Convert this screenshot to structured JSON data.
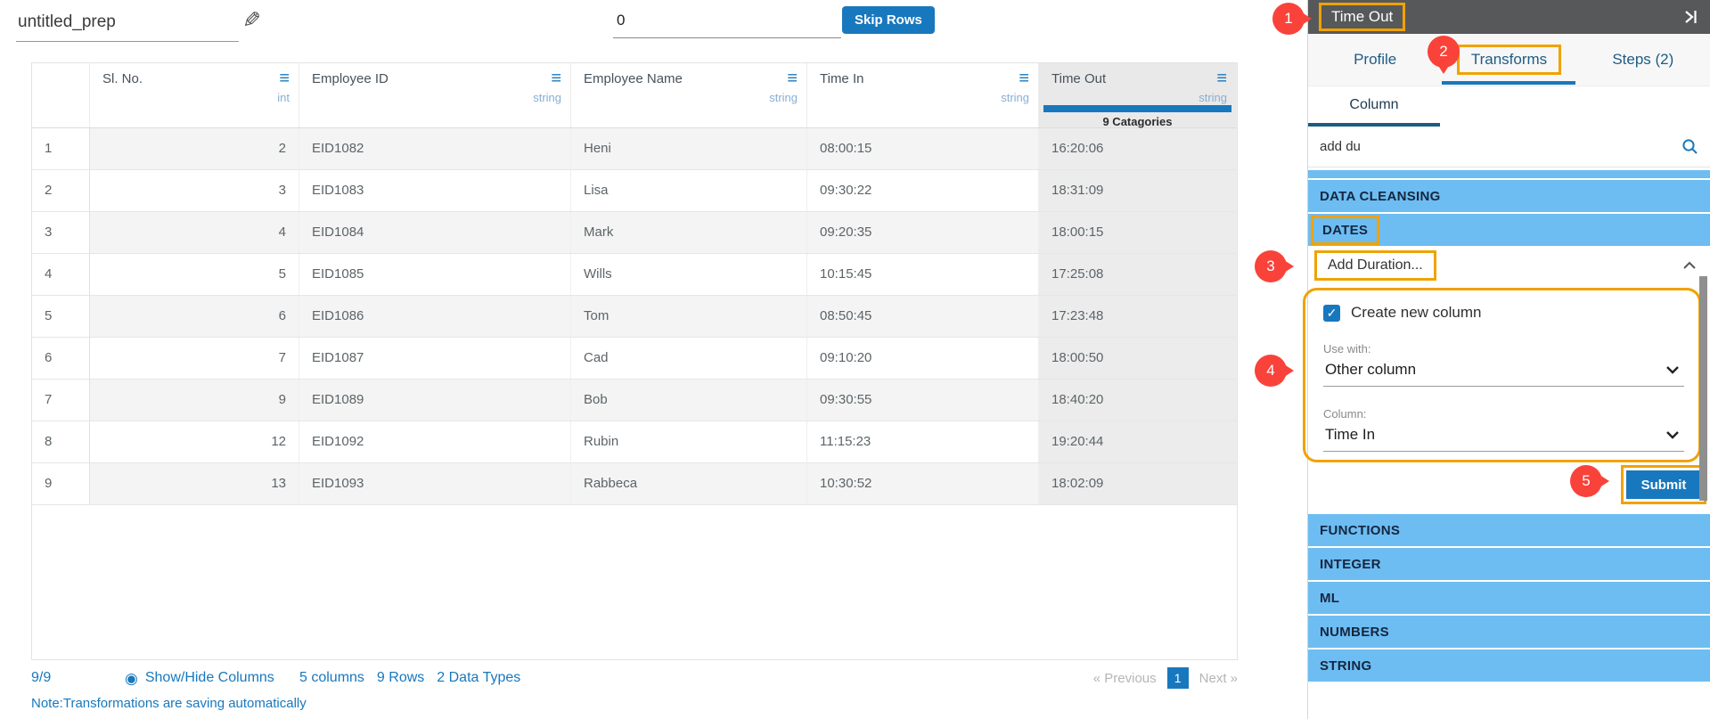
{
  "colors": {
    "accent_blue": "#1878be",
    "category_blue": "#6dbdf2",
    "annotation_orange": "#f0a202",
    "annotation_red": "#f9423a",
    "panel_header_gray": "#57585a"
  },
  "toolbar": {
    "prep_name": "untitled_prep",
    "skip_rows_value": "0",
    "skip_rows_label": "Skip Rows"
  },
  "grid": {
    "columns": [
      {
        "name": "Sl. No.",
        "type": "int"
      },
      {
        "name": "Employee ID",
        "type": "string"
      },
      {
        "name": "Employee Name",
        "type": "string"
      },
      {
        "name": "Time In",
        "type": "string"
      },
      {
        "name": "Time Out",
        "type": "string",
        "selected": true,
        "categories_label": "9 Catagories"
      }
    ],
    "rows": [
      {
        "n": "1",
        "cells": [
          "2",
          "EID1082",
          "Heni",
          "08:00:15",
          "16:20:06"
        ]
      },
      {
        "n": "2",
        "cells": [
          "3",
          "EID1083",
          "Lisa",
          "09:30:22",
          "18:31:09"
        ]
      },
      {
        "n": "3",
        "cells": [
          "4",
          "EID1084",
          "Mark",
          "09:20:35",
          "18:00:15"
        ]
      },
      {
        "n": "4",
        "cells": [
          "5",
          "EID1085",
          "Wills",
          "10:15:45",
          "17:25:08"
        ]
      },
      {
        "n": "5",
        "cells": [
          "6",
          "EID1086",
          "Tom",
          "08:50:45",
          "17:23:48"
        ]
      },
      {
        "n": "6",
        "cells": [
          "7",
          "EID1087",
          "Cad",
          "09:10:20",
          "18:00:50"
        ]
      },
      {
        "n": "7",
        "cells": [
          "9",
          "EID1089",
          "Bob",
          "09:30:55",
          "18:40:20"
        ]
      },
      {
        "n": "8",
        "cells": [
          "12",
          "EID1092",
          "Rubin",
          "11:15:23",
          "19:20:44"
        ]
      },
      {
        "n": "9",
        "cells": [
          "13",
          "EID1093",
          "Rabbeca",
          "10:30:52",
          "18:02:09"
        ]
      }
    ]
  },
  "footer": {
    "row_count": "9/9",
    "show_hide_label": "Show/Hide Columns",
    "summary": [
      "5 columns",
      "9 Rows",
      "2 Data Types"
    ],
    "pagination": {
      "previous": "« Previous",
      "page": "1",
      "next": "Next »"
    },
    "note": "Note:Transformations are saving automatically"
  },
  "panel": {
    "title": "Time Out",
    "tabs": [
      {
        "label": "Profile"
      },
      {
        "label": "Transforms",
        "active": true
      },
      {
        "label": "Steps (2)"
      }
    ],
    "subtab_label": "Column",
    "search_value": "add du",
    "categories_top": [
      {
        "label": "DATA CLEANSING"
      },
      {
        "label": "DATES",
        "highlighted": true
      }
    ],
    "transform": {
      "name": "Add Duration...",
      "checkbox_label": "Create new column",
      "checkbox_checked": true,
      "use_with_label": "Use with:",
      "use_with_value": "Other column",
      "column_label": "Column:",
      "column_value": "Time In",
      "submit_label": "Submit"
    },
    "categories_bottom": [
      {
        "label": "FUNCTIONS"
      },
      {
        "label": "INTEGER"
      },
      {
        "label": "ML"
      },
      {
        "label": "NUMBERS"
      },
      {
        "label": "STRING"
      }
    ]
  },
  "annotations": {
    "badges": [
      "1",
      "2",
      "3",
      "4",
      "5"
    ]
  }
}
